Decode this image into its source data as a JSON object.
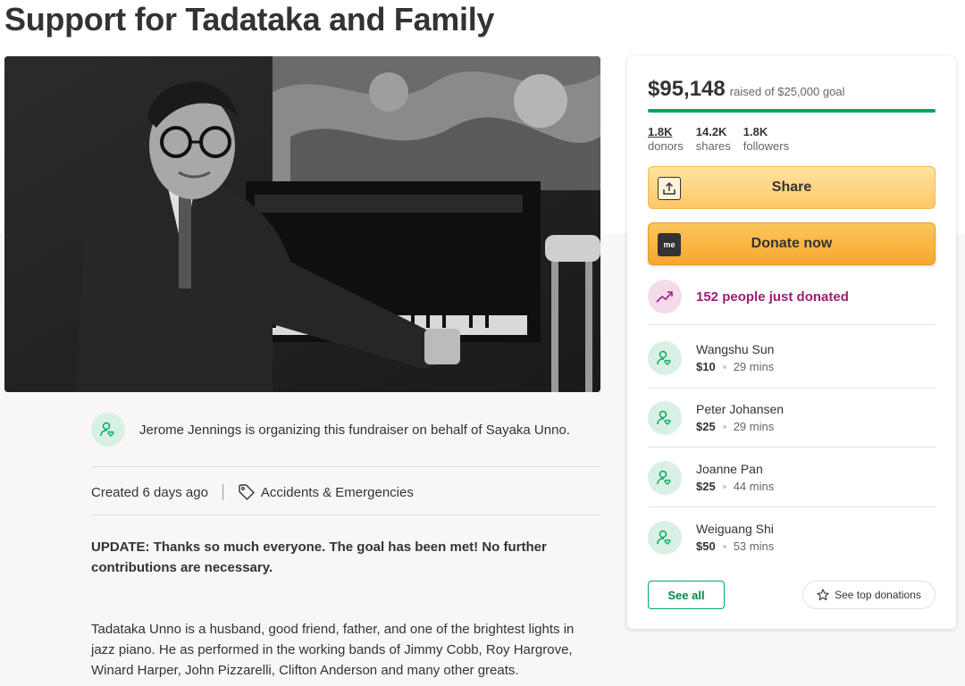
{
  "page": {
    "title": "Support for Tadataka and Family"
  },
  "organizer": {
    "text": "Jerome Jennings is organizing this fundraiser on behalf of Sayaka Unno."
  },
  "meta": {
    "created": "Created 6 days ago",
    "category": "Accidents & Emergencies"
  },
  "update": "UPDATE: Thanks so much everyone. The goal has been met! No further contributions are necessary.",
  "story": "Tadataka Unno is a husband, good friend, father, and one of the brightest lights in jazz piano. He as performed in the working bands of Jimmy Cobb, Roy Hargrove, Winard Harper, John Pizzarelli, Clifton Anderson and many other greats.",
  "campaign": {
    "raised": "$95,148",
    "goal_text": "raised of $25,000 goal",
    "progress": 1.0,
    "stats": [
      {
        "value": "1.8K",
        "label": "donors"
      },
      {
        "value": "14.2K",
        "label": "shares"
      },
      {
        "value": "1.8K",
        "label": "followers"
      }
    ],
    "share_label": "Share",
    "donate_label": "Donate now",
    "donate_icon_text": "me",
    "recent_text": "152 people just donated",
    "donations": [
      {
        "name": "Wangshu Sun",
        "amount": "$10",
        "time": "29 mins"
      },
      {
        "name": "Peter Johansen",
        "amount": "$25",
        "time": "29 mins"
      },
      {
        "name": "Joanne Pan",
        "amount": "$25",
        "time": "44 mins"
      },
      {
        "name": "Weiguang Shi",
        "amount": "$50",
        "time": "53 mins"
      }
    ],
    "see_all_label": "See all",
    "top_donations_label": "See top donations"
  },
  "colors": {
    "accent_green": "#02a95c",
    "donate_orange": "#f7a630",
    "trend_magenta": "#9b1e76"
  },
  "icons": {
    "organizer": "heart-person-icon",
    "category": "tag-icon",
    "share": "upload-icon",
    "trend": "trending-up-icon",
    "donor": "heart-person-icon",
    "star": "star-icon"
  }
}
